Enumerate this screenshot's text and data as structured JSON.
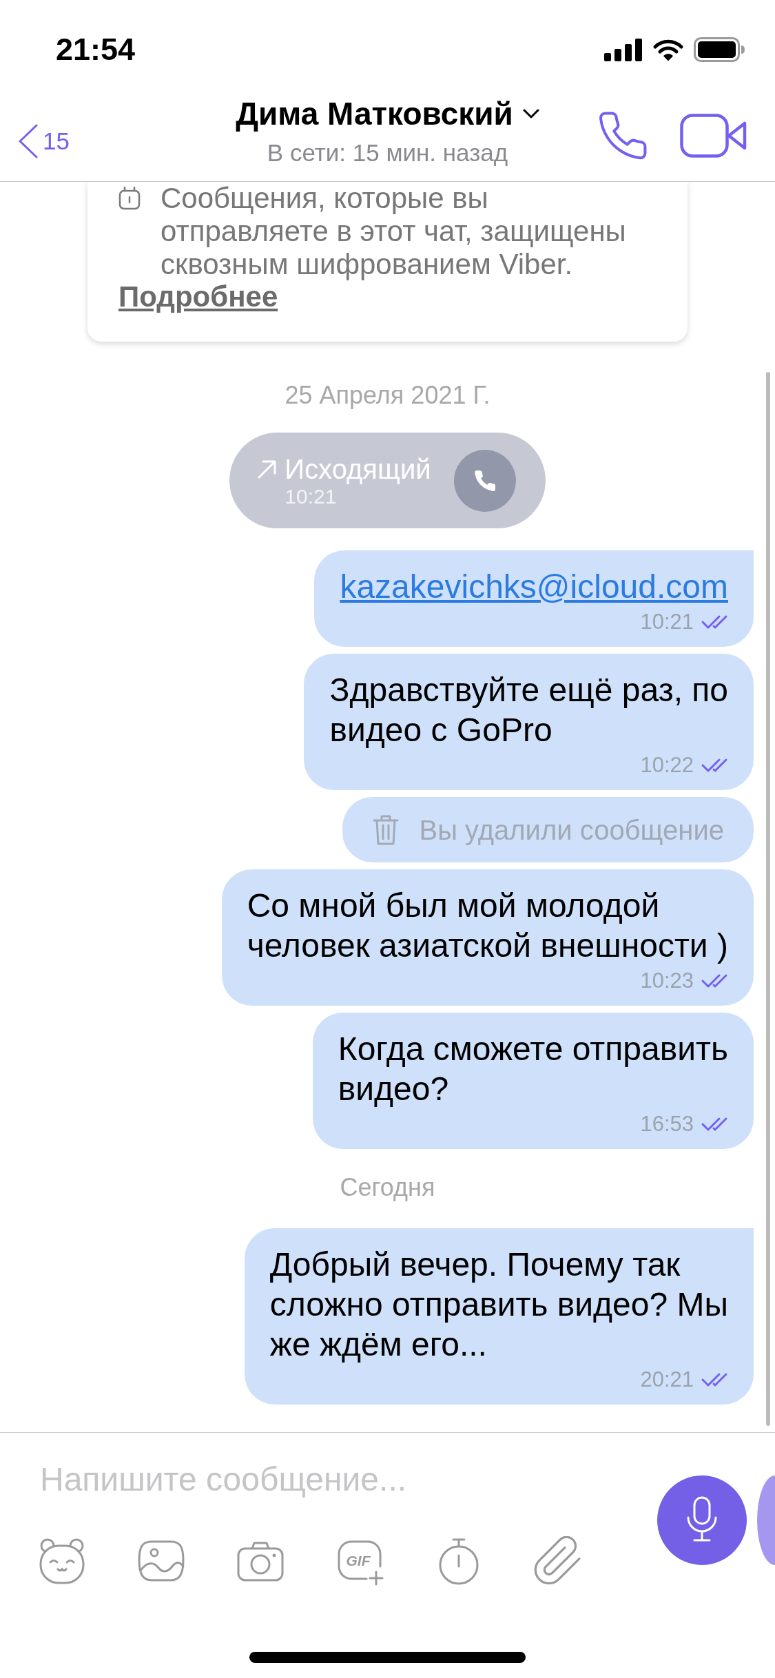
{
  "status_bar": {
    "time": "21:54"
  },
  "header": {
    "unread_count": "15",
    "contact_name": "Дима Матковский",
    "status": "В сети: 15 мин. назад"
  },
  "chat": [
    {
      "kind": "notice",
      "text": "Сообщения, которые вы\nотправляете в этот чат, защищены\nсквозным шифрованием Viber.",
      "more_link": "Подробнее"
    },
    {
      "kind": "date",
      "text": "25 Апреля 2021 Г."
    },
    {
      "kind": "call",
      "outgoing": true,
      "label": "Исходящий",
      "time": "10:21"
    },
    {
      "kind": "message",
      "text": "kazakevichks@icloud.com",
      "link": true,
      "time": "10:21",
      "read": true
    },
    {
      "kind": "message",
      "text": "Здравствуйте ещё раз, по\nвидео с GoPro",
      "link": false,
      "time": "10:22",
      "read": true
    },
    {
      "kind": "deleted",
      "text": "Вы удалили сообщение"
    },
    {
      "kind": "message",
      "text": "Со мной был мой молодой\nчеловек азиатской внешности )",
      "link": false,
      "time": "10:23",
      "read": true
    },
    {
      "kind": "message",
      "text": "Когда сможете отправить\nвидео?",
      "link": false,
      "time": "16:53",
      "read": true
    },
    {
      "kind": "date",
      "text": "Сегодня"
    },
    {
      "kind": "message",
      "text": "Добрый вечер. Почему так\nсложно отправить видео? Мы\nже ждём его...",
      "link": false,
      "time": "20:21",
      "read": true
    }
  ],
  "composer": {
    "placeholder": "Напишите сообщение...",
    "gif_label": "GIF"
  }
}
